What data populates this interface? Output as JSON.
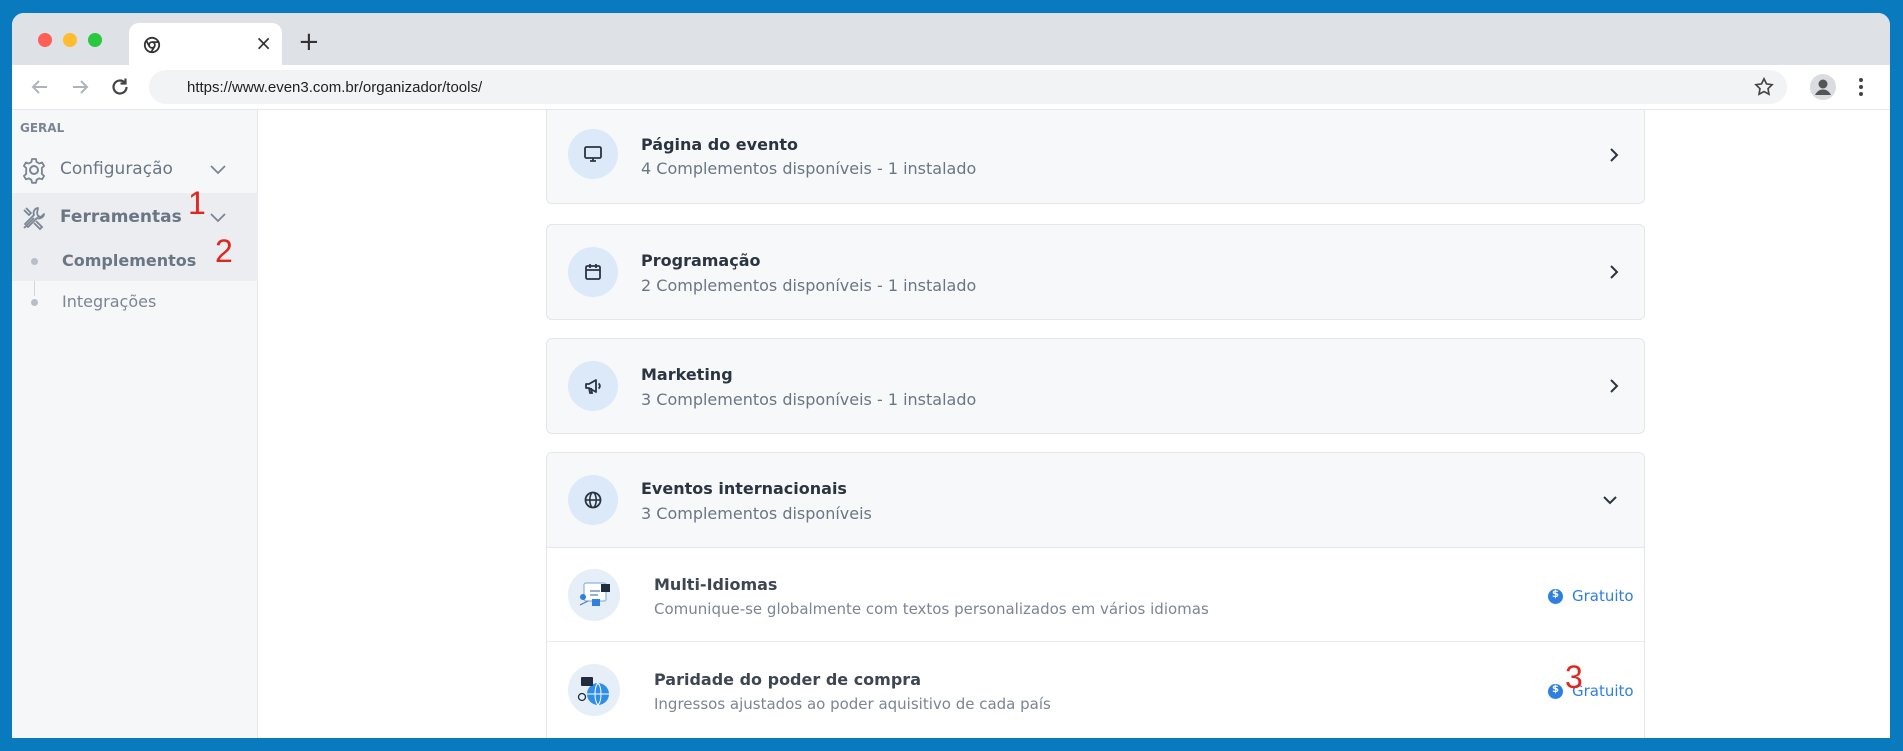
{
  "browser": {
    "url": "https://www.even3.com.br/organizador/tools/",
    "tab_close": "×",
    "new_tab": "+"
  },
  "sidebar": {
    "section": "GERAL",
    "items": [
      {
        "label": "Configuração"
      },
      {
        "label": "Ferramentas"
      }
    ],
    "subitems": [
      {
        "label": "Complementos"
      },
      {
        "label": "Integrações"
      }
    ]
  },
  "annotations": [
    "1",
    "2",
    "3"
  ],
  "cards": [
    {
      "title": "Página do evento",
      "subtitle": "4 Complementos disponíveis - 1 instalado"
    },
    {
      "title": "Programação",
      "subtitle": "2 Complementos disponíveis - 1 instalado"
    },
    {
      "title": "Marketing",
      "subtitle": "3 Complementos disponíveis - 1 instalado"
    },
    {
      "title": "Eventos internacionais",
      "subtitle": "3 Complementos disponíveis"
    }
  ],
  "addons": [
    {
      "name": "Multi-Idiomas",
      "description": "Comunique-se globalmente com textos personalizados em vários idiomas",
      "price": "Gratuito"
    },
    {
      "name": "Paridade do poder de compra",
      "description": "Ingressos ajustados ao poder aquisitivo de cada país",
      "price": "Gratuito"
    }
  ],
  "colors": {
    "accent": "#2f7fe0",
    "annotation": "#e0261e",
    "frame": "#0a7abf"
  }
}
